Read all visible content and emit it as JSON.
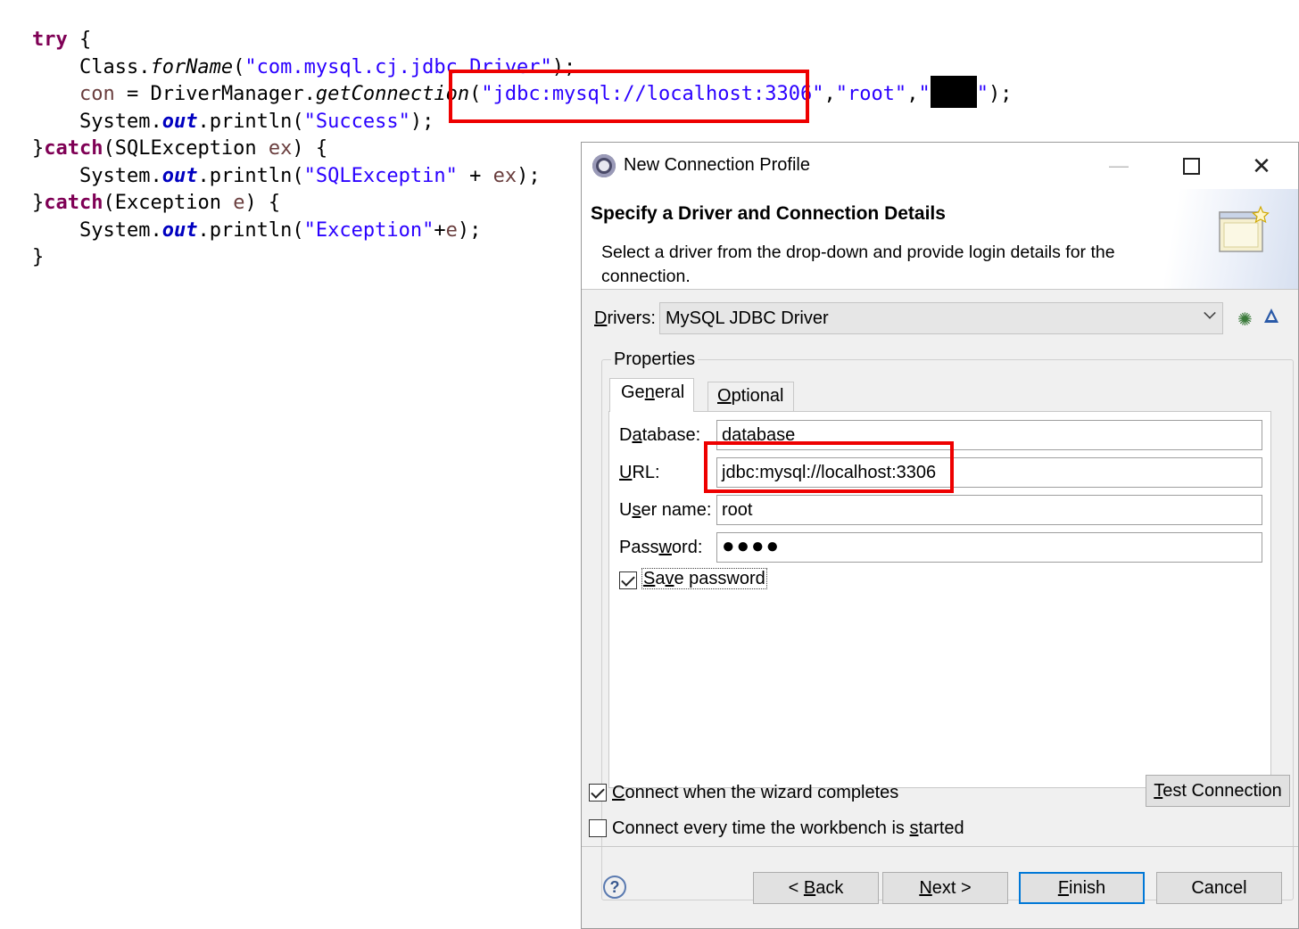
{
  "code": {
    "lines": [
      [
        {
          "t": "try",
          "c": "kw"
        },
        {
          "t": " {"
        }
      ],
      [
        {
          "t": "    Class."
        },
        {
          "t": "forName",
          "c": "mth"
        },
        {
          "t": "("
        },
        {
          "t": "\"com.mysql.cj.jdbc.Driver\"",
          "c": "str"
        },
        {
          "t": ");"
        }
      ],
      [
        {
          "t": "    "
        },
        {
          "t": "con",
          "c": "var"
        },
        {
          "t": " = DriverManager."
        },
        {
          "t": "getConnection",
          "c": "mth"
        },
        {
          "t": "("
        },
        {
          "t": "\"jdbc:mysql://localhost:3306\"",
          "c": "str"
        },
        {
          "t": ","
        },
        {
          "t": "\"root\"",
          "c": "str"
        },
        {
          "t": ","
        },
        {
          "t": "\"",
          "c": "str"
        },
        {
          "redact": true
        },
        {
          "t": "\"",
          "c": "str"
        },
        {
          "t": ");"
        }
      ],
      [
        {
          "t": "    System."
        },
        {
          "t": "out",
          "c": "fld"
        },
        {
          "t": ".println("
        },
        {
          "t": "\"Success\"",
          "c": "str"
        },
        {
          "t": ");"
        }
      ],
      [
        {
          "t": "}"
        },
        {
          "t": "catch",
          "c": "kw"
        },
        {
          "t": "(SQLException "
        },
        {
          "t": "ex",
          "c": "var"
        },
        {
          "t": ") {"
        }
      ],
      [
        {
          "t": "    System."
        },
        {
          "t": "out",
          "c": "fld"
        },
        {
          "t": ".println("
        },
        {
          "t": "\"SQLExceptin\"",
          "c": "str"
        },
        {
          "t": " + "
        },
        {
          "t": "ex",
          "c": "var"
        },
        {
          "t": ");"
        }
      ],
      [
        {
          "t": "}"
        },
        {
          "t": "catch",
          "c": "kw"
        },
        {
          "t": "(Exception "
        },
        {
          "t": "e",
          "c": "var"
        },
        {
          "t": ") {"
        }
      ],
      [
        {
          "t": "    System."
        },
        {
          "t": "out",
          "c": "fld"
        },
        {
          "t": ".println("
        },
        {
          "t": "\"Exception\"",
          "c": "str"
        },
        {
          "t": "+"
        },
        {
          "t": "e",
          "c": "var"
        },
        {
          "t": ");"
        }
      ],
      [
        {
          "t": "}"
        }
      ]
    ]
  },
  "dialog": {
    "window_title": "New Connection Profile",
    "banner_title": "Specify a Driver and Connection Details",
    "banner_desc": "Select a driver from the drop-down and provide login details for the connection.",
    "drivers_label": "Drivers:",
    "driver_selected": "MySQL JDBC Driver",
    "group_label": "Properties",
    "tabs": [
      "General",
      "Optional"
    ],
    "fields": {
      "database_label": "Database:",
      "database_value": "database",
      "url_label": "URL:",
      "url_value": "jdbc:mysql://localhost:3306",
      "username_label": "User name:",
      "username_value": "root",
      "password_label": "Password:",
      "password_value": "●●●●"
    },
    "save_password": {
      "label": "Save password",
      "checked": true
    },
    "connect_on_complete": {
      "label": "Connect when the wizard completes",
      "checked": true
    },
    "connect_on_start": {
      "label": "Connect every time the workbench is started",
      "checked": false
    },
    "test_connection": "Test Connection",
    "buttons": {
      "back": "< Back",
      "next": "Next >",
      "finish": "Finish",
      "cancel": "Cancel"
    },
    "help": "?"
  },
  "colors": {
    "highlight": "#ee0000",
    "keyword": "#7f0055",
    "string": "#2a00ff",
    "field": "#0000c0"
  },
  "icons": [
    "app-icon",
    "minimize-icon",
    "maximize-icon",
    "close-icon",
    "wizard-banner-icon",
    "chevron-down-icon",
    "new-driver-icon",
    "edit-driver-icon",
    "help-icon"
  ]
}
